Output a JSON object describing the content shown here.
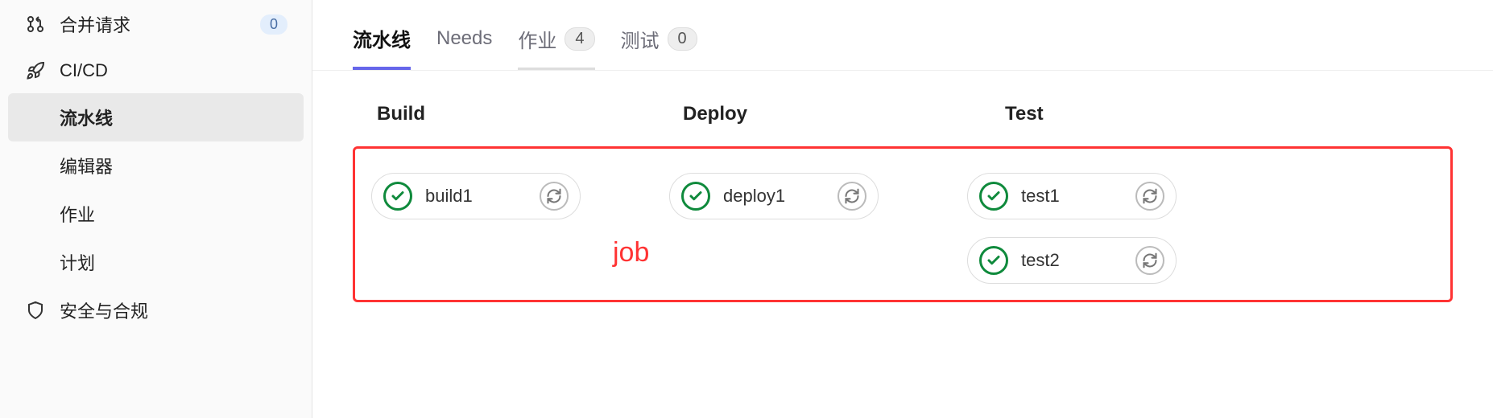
{
  "sidebar": {
    "items": [
      {
        "label": "合并请求",
        "badge": "0"
      },
      {
        "label": "CI/CD"
      },
      {
        "label": "流水线"
      },
      {
        "label": "编辑器"
      },
      {
        "label": "作业"
      },
      {
        "label": "计划"
      },
      {
        "label": "安全与合规"
      }
    ]
  },
  "tabs": [
    {
      "label": "流水线"
    },
    {
      "label": "Needs"
    },
    {
      "label": "作业",
      "count": "4"
    },
    {
      "label": "测试",
      "count": "0"
    }
  ],
  "stages": [
    {
      "name": "Build",
      "jobs": [
        {
          "name": "build1"
        }
      ]
    },
    {
      "name": "Deploy",
      "jobs": [
        {
          "name": "deploy1"
        }
      ]
    },
    {
      "name": "Test",
      "jobs": [
        {
          "name": "test1"
        },
        {
          "name": "test2"
        }
      ]
    }
  ],
  "annotation": "job"
}
